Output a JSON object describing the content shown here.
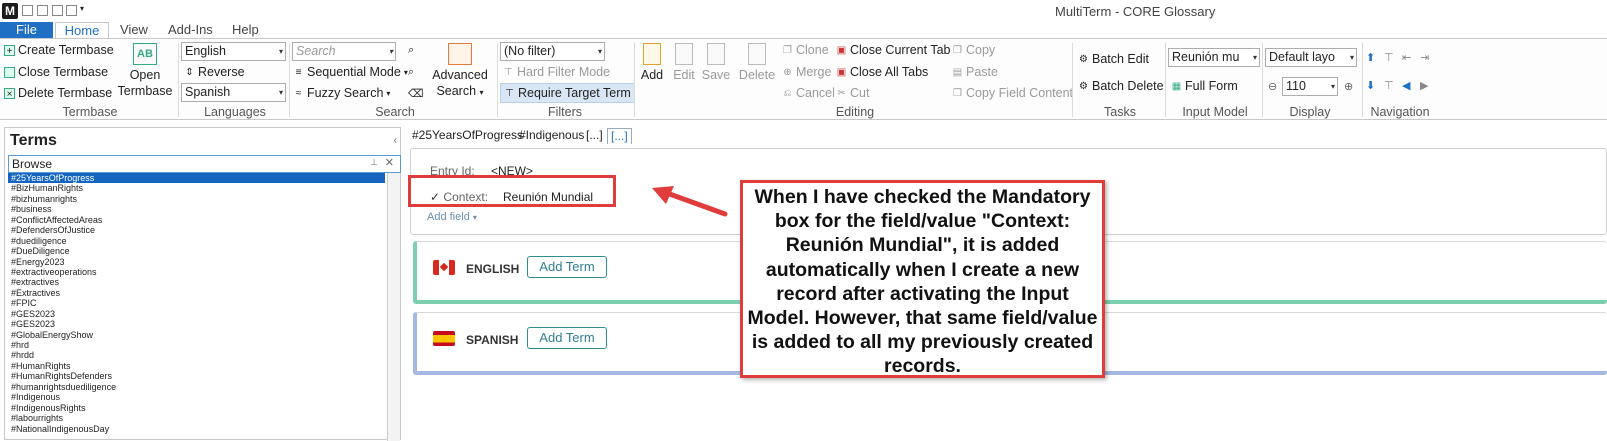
{
  "window": {
    "title": "MultiTerm - CORE Glossary",
    "logo": "M"
  },
  "tabs": [
    "File",
    "Home",
    "View",
    "Add-Ins",
    "Help"
  ],
  "ribbon": {
    "termbase": {
      "create": "Create Termbase",
      "close": "Close Termbase",
      "delete": "Delete Termbase",
      "open": "Open\nTermbase",
      "label": "Termbase"
    },
    "languages": {
      "source": "English",
      "reverse": "Reverse",
      "target": "Spanish",
      "label": "Languages"
    },
    "search": {
      "placeholder": "Search",
      "sequential": "Sequential Mode",
      "fuzzy": "Fuzzy Search",
      "advanced": "Advanced",
      "advanced2": "Search",
      "label": "Search"
    },
    "filters": {
      "filter": "(No filter)",
      "hard": "Hard Filter Mode",
      "require": "Require Target Term",
      "label": "Filters"
    },
    "editing": {
      "add": "Add",
      "edit": "Edit",
      "save": "Save",
      "delete": "Delete",
      "clone": "Clone",
      "merge": "Merge",
      "cancel": "Cancel",
      "close_current": "Close Current Tab",
      "close_all": "Close All Tabs",
      "cut": "Cut",
      "copy": "Copy",
      "paste": "Paste",
      "copy_field": "Copy Field Content",
      "label": "Editing"
    },
    "tasks": {
      "batch_edit": "Batch Edit",
      "batch_delete": "Batch Delete",
      "label": "Tasks"
    },
    "input_model": {
      "value": "Reunión mu",
      "full_form": "Full Form",
      "label": "Input Model"
    },
    "display": {
      "layout": "Default layo",
      "zoom": "110",
      "label": "Display"
    },
    "navigation": {
      "label": "Navigation"
    }
  },
  "terms": {
    "title": "Terms",
    "browse": "Browse",
    "items": [
      "#25YearsOfProgress",
      "#BizHumanRights",
      "#bizhumanrights",
      "#business",
      "#ConflictAffectedAreas",
      "#DefendersOfJustice",
      "#duediligence",
      "#DueDiligence",
      "#Energy2023",
      "#extractiveoperations",
      "#extractives",
      "#Extractives",
      "#FPIC",
      "#GES2023",
      "#GES2023",
      "#GlobalEnergyShow",
      "#hrd",
      "#hrdd",
      "#HumanRights",
      "#HumanRightsDefenders",
      "#humanrightsduediligence",
      "#Indigenous",
      "#IndigenousRights",
      "#labourrights",
      "#NationalIndigenousDay"
    ]
  },
  "doc_tabs": [
    "#25YearsOfProgress",
    "#Indigenous",
    "[...]",
    "[...]"
  ],
  "entry": {
    "id_label": "Entry Id:",
    "id_value": "<NEW>",
    "context_label": "Context:",
    "context_value": "Reunión Mundial",
    "add_field": "Add field"
  },
  "languages_panel": [
    {
      "name": "ENGLISH",
      "button": "Add Term"
    },
    {
      "name": "SPANISH",
      "button": "Add Term"
    }
  ],
  "callout": "When I have checked the Mandatory box for the field/value \"Context: Reunión Mundial\", it is added automatically when I create a new record after activating the Input Model. However, that same field/value is added to all my previously created records.",
  "colors": {
    "accent": "#1f6fc4",
    "annotation": "#e03c3c",
    "english": "#7dcfb0",
    "spanish": "#a5b8e0"
  }
}
